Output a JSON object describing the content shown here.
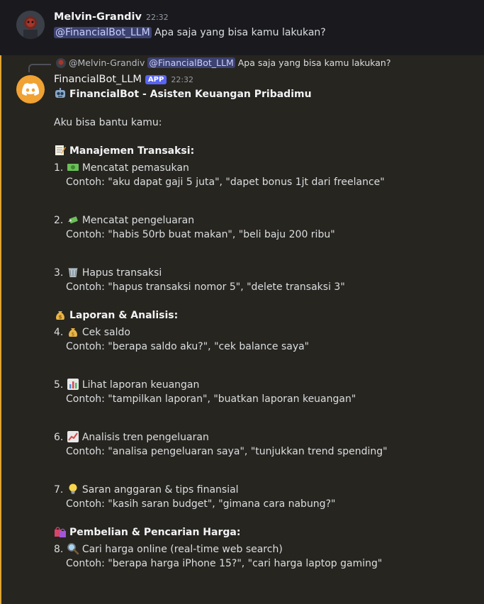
{
  "user_message": {
    "author": "Melvin-Grandiv",
    "time": "22:32",
    "mention": "@FinancialBot_LLM",
    "text": "Apa saja yang bisa kamu lakukan?"
  },
  "reply_preview": {
    "author": "@Melvin-Grandiv",
    "mention": "@FinancialBot_LLM",
    "text": "Apa saja yang bisa kamu lakukan?"
  },
  "bot_message": {
    "author": "FinancialBot_LLM",
    "tag": "APP",
    "time": "22:32",
    "title": "FinancialBot - Asisten Keuangan Pribadimu",
    "intro": "Aku bisa bantu kamu:",
    "sections": [
      {
        "heading": "Manajemen Transaksi:",
        "items": [
          {
            "num": "1.",
            "label": "Mencatat pemasukan",
            "example": "Contoh: \"aku dapat gaji 5 juta\", \"dapet bonus 1jt dari freelance\""
          },
          {
            "num": "2.",
            "label": "Mencatat pengeluaran",
            "example": "Contoh: \"habis 50rb buat makan\", \"beli baju 200 ribu\""
          },
          {
            "num": "3.",
            "label": "Hapus transaksi",
            "example": "Contoh: \"hapus transaksi nomor 5\", \"delete transaksi 3\""
          }
        ]
      },
      {
        "heading": "Laporan & Analisis:",
        "items": [
          {
            "num": "4.",
            "label": "Cek saldo",
            "example": "Contoh: \"berapa saldo aku?\", \"cek balance saya\""
          },
          {
            "num": "5.",
            "label": "Lihat laporan keuangan",
            "example": "Contoh: \"tampilkan laporan\", \"buatkan laporan keuangan\""
          },
          {
            "num": "6.",
            "label": "Analisis tren pengeluaran",
            "example": "Contoh: \"analisa pengeluaran saya\", \"tunjukkan trend spending\""
          },
          {
            "num": "7.",
            "label": "Saran anggaran & tips finansial",
            "example": "Contoh: \"kasih saran budget\", \"gimana cara nabung?\""
          }
        ]
      },
      {
        "heading": "Pembelian & Pencarian Harga:",
        "items": [
          {
            "num": "8.",
            "label": "Cari harga online (real-time web search)",
            "example": "Contoh: \"berapa harga iPhone 15?\", \"cari harga laptop gaming\""
          }
        ]
      }
    ]
  },
  "colors": {
    "accent_bar": "#e1a534",
    "bot_avatar": "#f0a232",
    "mention_bg": "#3c4270",
    "app_tag": "#5865f2"
  },
  "icons": [
    "robot-icon",
    "memo-icon",
    "dollar-bill-icon",
    "money-wings-icon",
    "wastebasket-icon",
    "money-bag-icon",
    "bar-chart-icon",
    "chart-up-icon",
    "lightbulb-icon",
    "shopping-bags-icon",
    "magnifier-icon"
  ]
}
